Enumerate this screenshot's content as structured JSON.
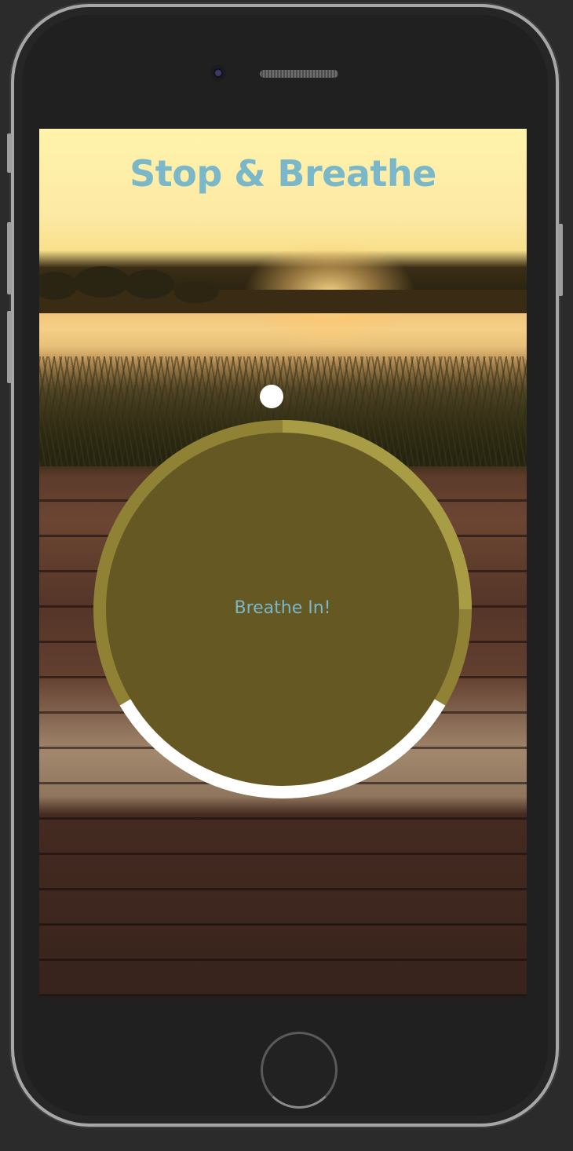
{
  "app": {
    "title": "Stop & Breathe"
  },
  "breathing": {
    "instruction": "Breathe In!",
    "progress_fraction": 0.33
  },
  "colors": {
    "title_text": "#79b7c9",
    "circle_fill": "#655822",
    "ring_track": "#8f8234",
    "ring_progress": "#ffffff",
    "ring_top_accent": "#a89c45"
  },
  "icons": {
    "camera": "front-camera-icon",
    "speaker": "earpiece-speaker-icon",
    "home": "home-button-icon",
    "indicator": "progress-dot-icon"
  }
}
